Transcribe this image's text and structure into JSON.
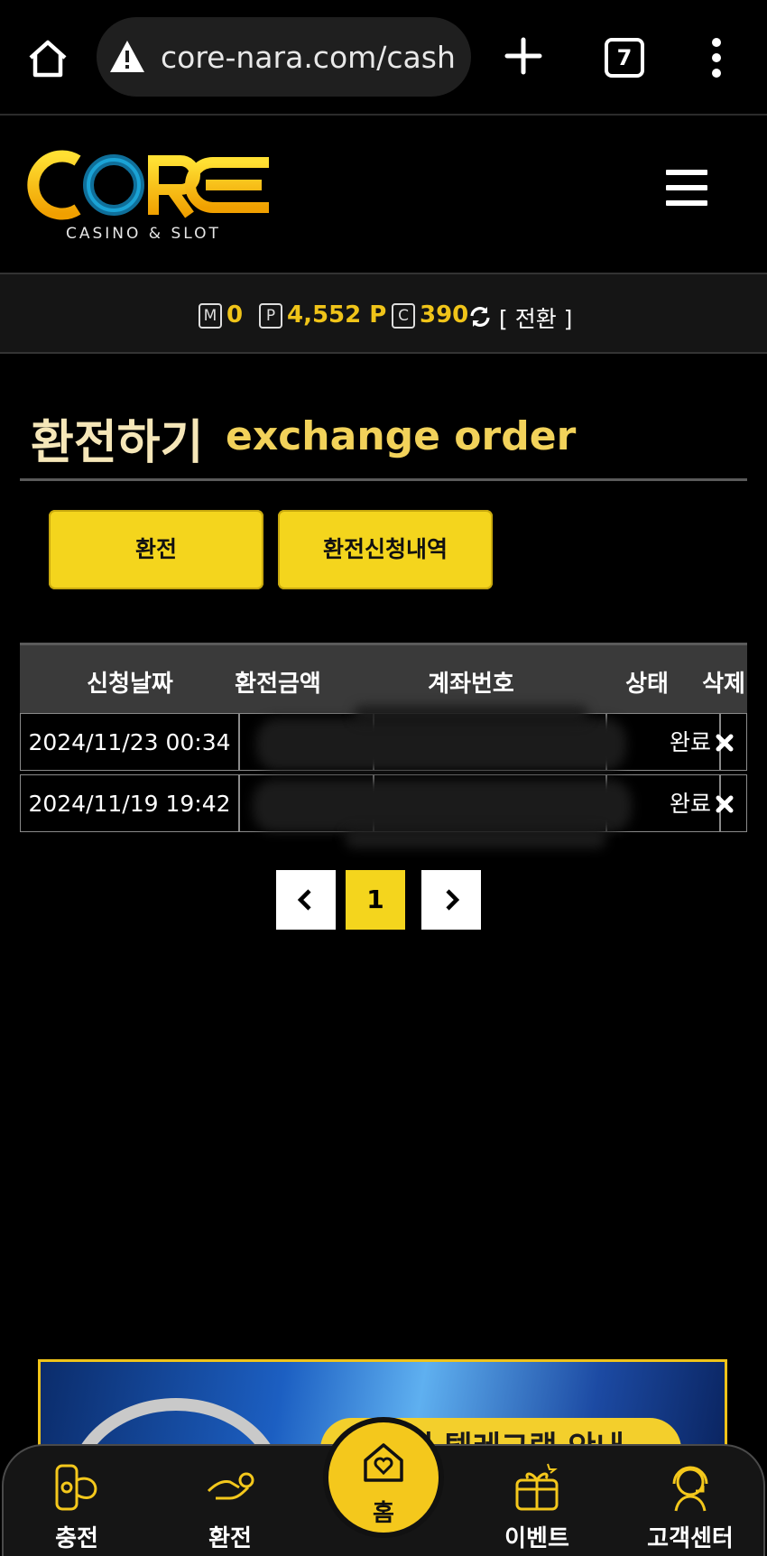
{
  "browser": {
    "url": "core-nara.com/cash_",
    "tab_count": "7"
  },
  "brand": {
    "logo_text": "CORE",
    "logo_tagline": "CASINO & SLOT",
    "accent_color": "#f4d51d"
  },
  "balances": {
    "money_icon": "M",
    "money_value": "0",
    "point_icon": "P",
    "point_value": "4,552 P",
    "coin_icon": "C",
    "coin_value": "390",
    "convert_label": "[ 전환 ]"
  },
  "page": {
    "title": "환전하기",
    "subtitle": "exchange order"
  },
  "tabs": {
    "exchange_label": "환전",
    "history_label": "환전신청내역"
  },
  "table": {
    "headers": [
      "신청날짜",
      "환전금액",
      "계좌번호",
      "상태",
      "삭제"
    ],
    "rows": [
      {
        "date": "2024/11/23 00:34",
        "amount": "",
        "account": "",
        "status": "완료"
      },
      {
        "date": "2024/11/19 19:42",
        "amount": "",
        "account": "",
        "status": "완료"
      }
    ]
  },
  "pagination": {
    "current": "1"
  },
  "banner": {
    "text": "코어 텔레그램 안내"
  },
  "bottom_nav": {
    "deposit": "충전",
    "exchange": "환전",
    "home": "홈",
    "event": "이벤트",
    "support": "고객센터"
  }
}
